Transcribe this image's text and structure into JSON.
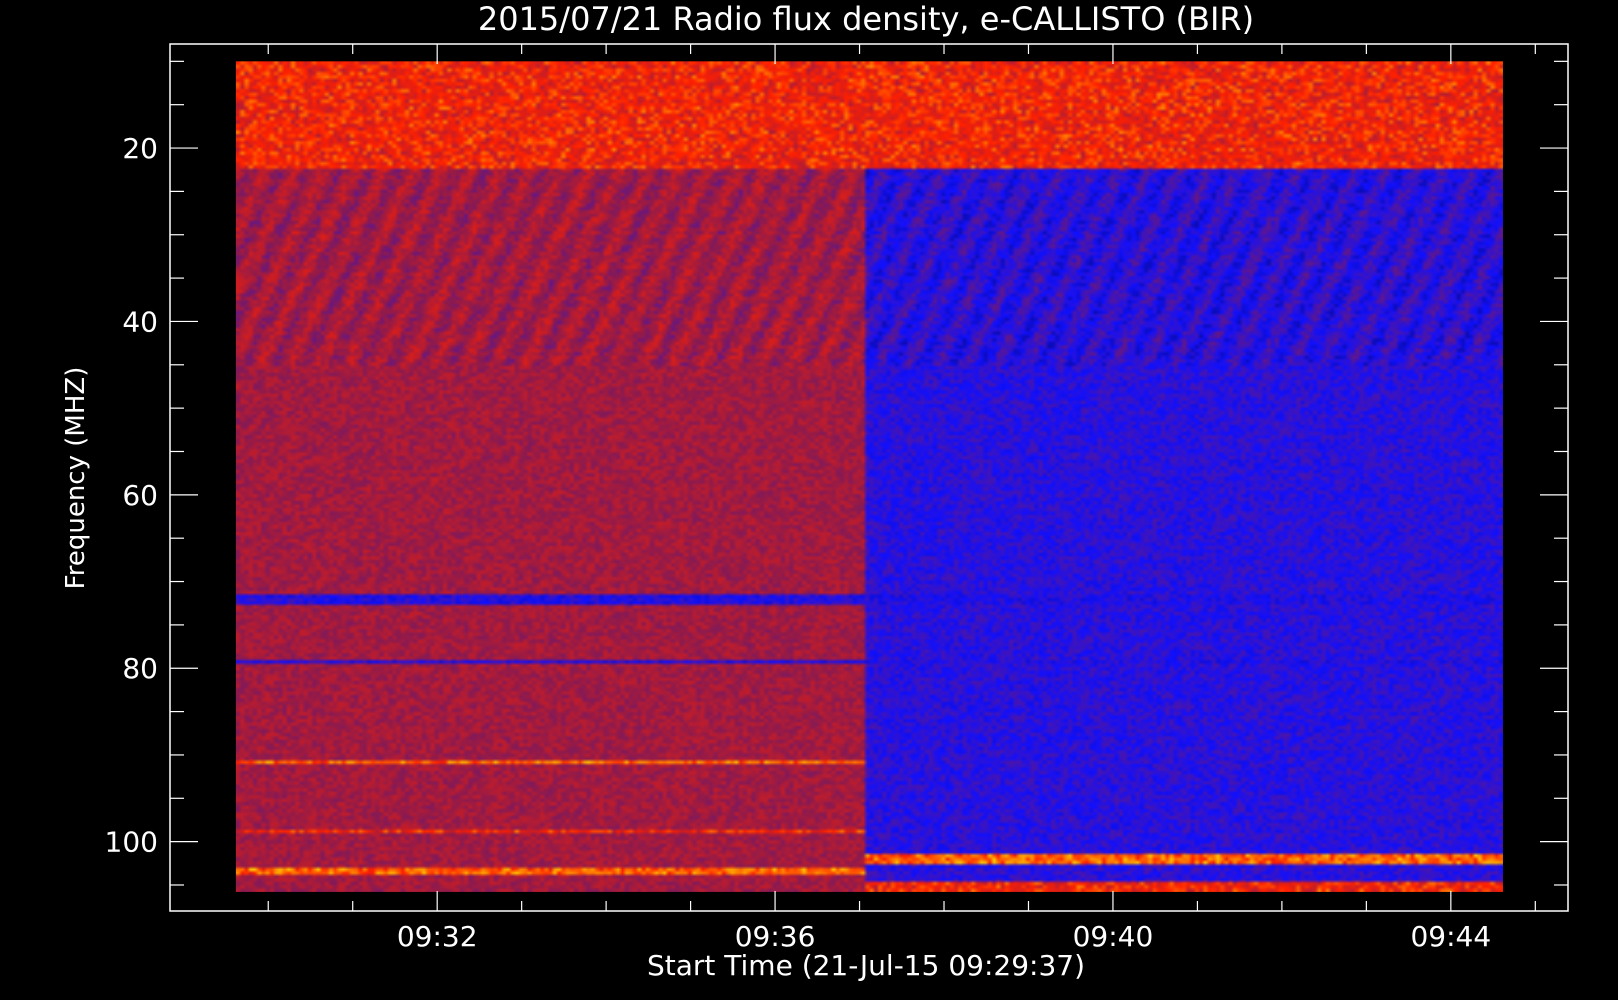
{
  "chart_data": {
    "type": "heatmap",
    "title": "2015/07/21  Radio flux density, e-CALLISTO (BIR)",
    "xlabel": "Start Time (21-Jul-15 09:29:37)",
    "ylabel": "Frequency (MHZ)",
    "x_tick_labels": [
      "09:32",
      "09:36",
      "09:40",
      "09:44"
    ],
    "x_tick_values_min": [
      2.383,
      6.383,
      10.383,
      14.383
    ],
    "y_tick_labels": [
      "20",
      "40",
      "60",
      "80",
      "100"
    ],
    "y_tick_values": [
      20,
      40,
      60,
      80,
      100
    ],
    "xlim_min": [
      -0.78,
      15.77
    ],
    "ylim_mhz": [
      8.0,
      108.0
    ],
    "y_inverted": true,
    "data_extent": {
      "t_min": [
        0.0,
        15.0
      ],
      "f_mhz": [
        10.0,
        105.8
      ]
    },
    "colormap": [
      "#000000",
      "#1010ff",
      "#8a1a50",
      "#ff2000",
      "#ffd000"
    ],
    "grid": false,
    "segments": [
      {
        "t_min": [
          0.0,
          7.45
        ],
        "background_level": 0.55,
        "note_color": "#4a20d8"
      },
      {
        "t_min": [
          7.45,
          15.0
        ],
        "background_level": 0.3,
        "note_color": "#1530f0"
      }
    ],
    "features": [
      {
        "kind": "band",
        "f_mhz": [
          10.0,
          22.5
        ],
        "t_min": [
          0.0,
          15.0
        ],
        "intensity": "high"
      },
      {
        "kind": "band",
        "f_mhz": [
          71.5,
          72.8
        ],
        "t_min": [
          0.0,
          15.0
        ],
        "intensity": "low"
      },
      {
        "kind": "band",
        "f_mhz": [
          79.0,
          79.6
        ],
        "t_min": [
          0.0,
          15.0
        ],
        "intensity": "low"
      },
      {
        "kind": "band",
        "f_mhz": [
          90.5,
          91.2
        ],
        "t_min": [
          0.0,
          7.45
        ],
        "intensity": "very-high"
      },
      {
        "kind": "band",
        "f_mhz": [
          98.5,
          99.0
        ],
        "t_min": [
          0.0,
          7.45
        ],
        "intensity": "high"
      },
      {
        "kind": "band",
        "f_mhz": [
          103.0,
          103.8
        ],
        "t_min": [
          0.0,
          7.45
        ],
        "intensity": "very-high"
      },
      {
        "kind": "band",
        "f_mhz": [
          101.5,
          102.8
        ],
        "t_min": [
          7.45,
          15.0
        ],
        "intensity": "very-high"
      },
      {
        "kind": "band",
        "f_mhz": [
          104.5,
          105.8
        ],
        "t_min": [
          7.45,
          15.0
        ],
        "intensity": "high"
      }
    ]
  }
}
